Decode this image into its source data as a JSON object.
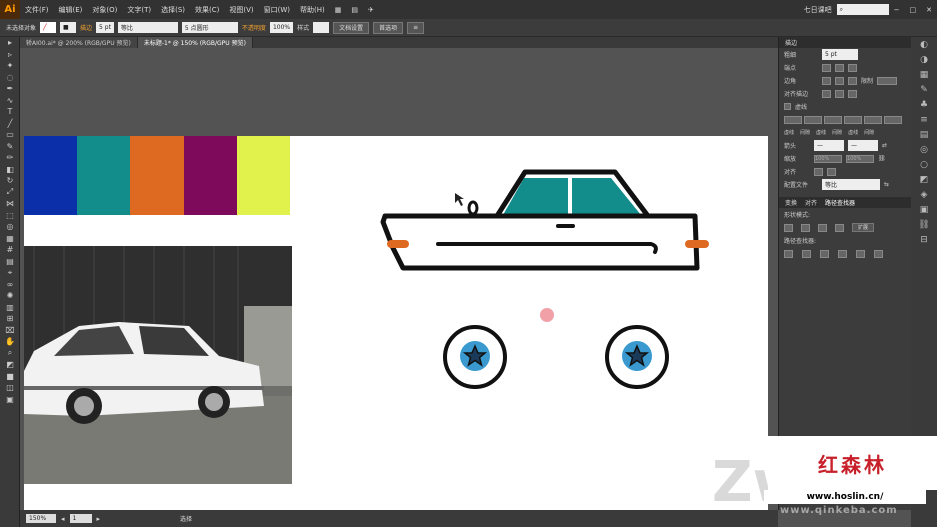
{
  "app": {
    "logo": "Ai"
  },
  "menu": [
    "文件(F)",
    "编辑(E)",
    "对象(O)",
    "文字(T)",
    "选择(S)",
    "效果(C)",
    "视图(V)",
    "窗口(W)",
    "帮助(H)"
  ],
  "header_right": {
    "workspace": "七日课吧",
    "search_icon": "search-icon"
  },
  "controlbar": {
    "selection": "未选择对象",
    "stroke_label": "描边",
    "stroke_weight": "5 pt",
    "stroke_profile": "等比",
    "brush": "5 点圆形",
    "opacity_label": "不透明度",
    "opacity_value": "100%",
    "style_label": "样式",
    "doc_setup": "文档设置",
    "preferences": "首选项"
  },
  "tabs": [
    {
      "label": "轿AI00.ai* @ 200% (RGB/GPU 预览)",
      "active": false
    },
    {
      "label": "未标题-1* @ 150% (RGB/GPU 预览)",
      "active": true
    }
  ],
  "swatch_colors": [
    "#0a2fa8",
    "#138c8c",
    "#de6a22",
    "#7d0a5a",
    "#e2f24c"
  ],
  "car_colors": {
    "body": "#ffffff",
    "window": "#138c8c",
    "outline": "#111111",
    "light": "#de6a22",
    "hub": "#3a9ad0",
    "dot": "#f2a0a8"
  },
  "statusbar": {
    "zoom": "150%",
    "page": "1",
    "mode": "选择"
  },
  "stroke_panel": {
    "title": "描边",
    "weight_label": "粗细",
    "weight_value": "5 pt",
    "cap_label": "端点",
    "corner_label": "边角",
    "limit_label": "限制",
    "align_label": "对齐描边",
    "dashed_label": "虚线",
    "dash_labels": [
      "虚线",
      "间隙",
      "虚线",
      "间隙",
      "虚线",
      "间隙"
    ],
    "arrow_label": "箭头",
    "scale_label": "缩放",
    "scale_values": [
      "100%",
      "100%"
    ],
    "align2_label": "对齐",
    "profile_label": "配置文件",
    "profile_value": "等比"
  },
  "pathfinder_panel": {
    "tabs": [
      "变换",
      "对齐",
      "路径查找器"
    ],
    "shape_modes": "形状模式:",
    "expand": "扩展",
    "pathfinders": "路径查找器:"
  },
  "watermark": {
    "name": "红森林",
    "url": "www.hoslin.cn/",
    "site": "www.qinkeba.com",
    "logo": "Zw"
  }
}
